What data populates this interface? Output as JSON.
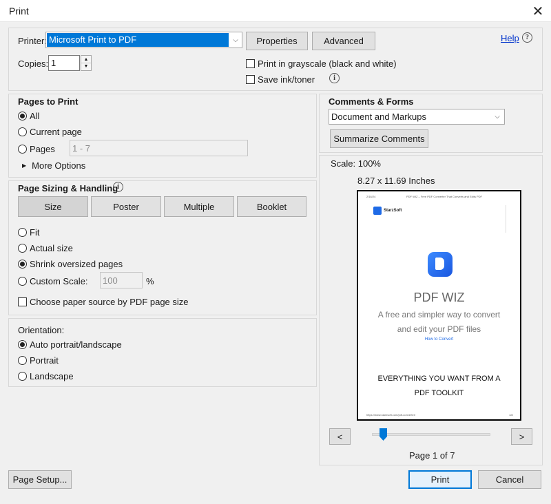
{
  "window": {
    "title": "Print",
    "close_glyph": "✕"
  },
  "printer": {
    "label": "Printer:",
    "selected": "Microsoft Print to PDF",
    "properties_label": "Properties",
    "advanced_label": "Advanced",
    "help_label": "Help",
    "help_glyph": "?"
  },
  "copies": {
    "label": "Copies:",
    "value": "1"
  },
  "options": {
    "grayscale_label": "Print in grayscale (black and white)",
    "save_ink_label": "Save ink/toner",
    "info_glyph": "i"
  },
  "pages_to_print": {
    "heading": "Pages to Print",
    "all_label": "All",
    "current_label": "Current page",
    "pages_label": "Pages",
    "pages_placeholder": "1 - 7",
    "more_options_label": "More Options",
    "more_glyph": "▶"
  },
  "sizing": {
    "heading": "Page Sizing & Handling",
    "tabs": [
      "Size",
      "Poster",
      "Multiple",
      "Booklet"
    ],
    "fit_label": "Fit",
    "actual_label": "Actual size",
    "shrink_label": "Shrink oversized pages",
    "custom_label": "Custom Scale:",
    "custom_value": "100",
    "percent": "%",
    "paper_source_label": "Choose paper source by PDF page size"
  },
  "orientation": {
    "heading": "Orientation:",
    "auto_label": "Auto portrait/landscape",
    "portrait_label": "Portrait",
    "landscape_label": "Landscape"
  },
  "comments": {
    "heading": "Comments & Forms",
    "selected": "Document and Markups",
    "summarize_label": "Summarize Comments"
  },
  "preview": {
    "scale_text": "Scale: 100%",
    "size_text": "8.27 x 11.69 Inches",
    "page_text": "Page 1 of 7",
    "prev_glyph": "<",
    "next_glyph": ">",
    "slider_fraction": 0.07,
    "doc": {
      "header_date": "2/16/24",
      "header_title": "PDF WIZ – Free PDF Converter That Converts and Edits PDF",
      "brand": "StarzSoft",
      "product": "PDF WIZ",
      "tagline_1": "A free and simpler way to convert",
      "tagline_2": "and edit your PDF files",
      "link": "How to Convert",
      "headline_1": "EVERYTHING YOU WANT FROM A",
      "headline_2": "PDF TOOLKIT",
      "footer_url": "https://www.starzsoft.com/pdf-converter/",
      "footer_page": "1/8"
    }
  },
  "footer": {
    "page_setup_label": "Page Setup...",
    "print_label": "Print",
    "cancel_label": "Cancel"
  },
  "dropdown_glyph": "⌵",
  "spin_up": "▲",
  "spin_down": "▼"
}
